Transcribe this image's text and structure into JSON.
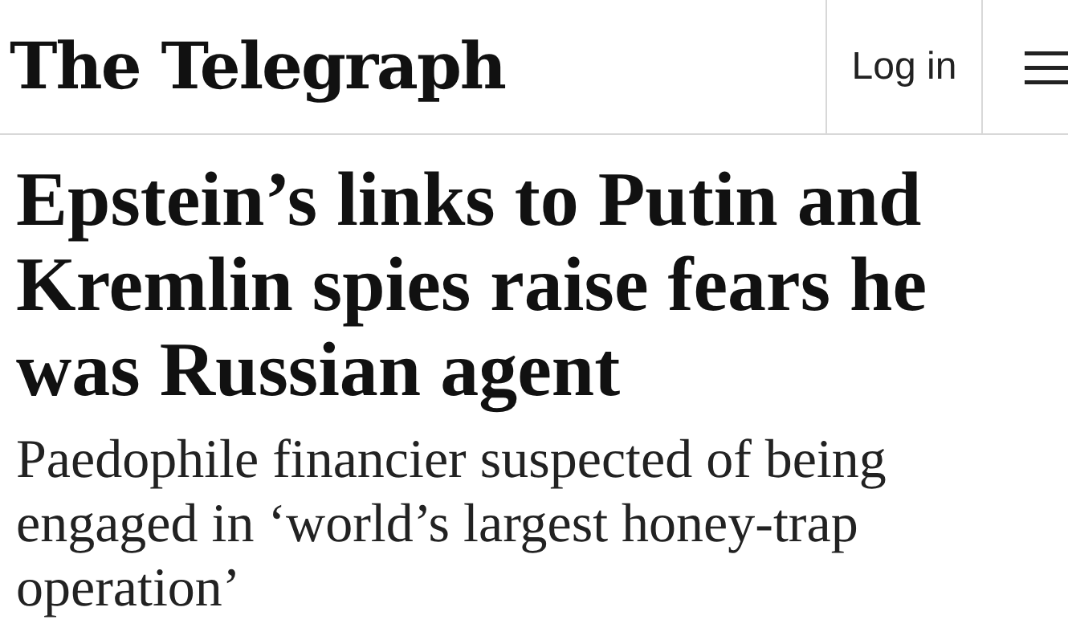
{
  "header": {
    "logo": "The Telegraph",
    "login": "Log in"
  },
  "article": {
    "headline": "Epstein’s links to Putin and Kremlin spies raise fears he was Russian agent",
    "standfirst": "Paedophile financier suspected of being engaged in ‘world’s largest honey-trap operation’"
  }
}
